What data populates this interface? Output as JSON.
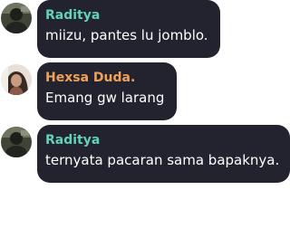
{
  "messages": [
    {
      "sender": "Raditya",
      "sender_color": "#5fd2b8",
      "text": "miizu, pantes lu jomblo.",
      "avatar_icon": "user-avatar-photo"
    },
    {
      "sender": "Hexsa Duda.",
      "sender_color": "#f0a25a",
      "text": "Emang gw larang",
      "avatar_icon": "user-avatar-photo"
    },
    {
      "sender": "Raditya",
      "sender_color": "#5fd2b8",
      "text": "ternyata pacaran sama bapaknya.",
      "avatar_icon": "user-avatar-photo"
    }
  ],
  "colors": {
    "bubble": "#23232f",
    "message_text": "#ffffff",
    "background": "#ffffff"
  }
}
